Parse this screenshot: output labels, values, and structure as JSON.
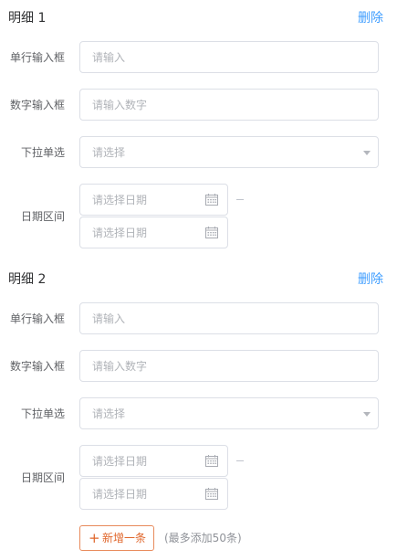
{
  "sections": [
    {
      "title": "明细 1",
      "delete_label": "删除",
      "fields": {
        "single_line": {
          "label": "单行输入框",
          "placeholder": "请输入"
        },
        "number": {
          "label": "数字输入框",
          "placeholder": "请输入数字"
        },
        "dropdown": {
          "label": "下拉单选",
          "placeholder": "请选择"
        },
        "date_range": {
          "label": "日期区间",
          "start_placeholder": "请选择日期",
          "end_placeholder": "请选择日期",
          "separator": "–"
        }
      }
    },
    {
      "title": "明细 2",
      "delete_label": "删除",
      "fields": {
        "single_line": {
          "label": "单行输入框",
          "placeholder": "请输入"
        },
        "number": {
          "label": "数字输入框",
          "placeholder": "请输入数字"
        },
        "dropdown": {
          "label": "下拉单选",
          "placeholder": "请选择"
        },
        "date_range": {
          "label": "日期区间",
          "start_placeholder": "请选择日期",
          "end_placeholder": "请选择日期",
          "separator": "–"
        }
      }
    }
  ],
  "footer": {
    "add_icon": "+",
    "add_label": "新增一条",
    "limit_note": "(最多添加50条)"
  },
  "icons": {
    "calendar": "calendar-icon",
    "dropdown": "chevron-down-icon",
    "add": "plus-icon"
  },
  "colors": {
    "link": "#409eff",
    "add_accent": "#e0662b",
    "border": "#dcdfe6",
    "placeholder": "#b0b3b8"
  }
}
